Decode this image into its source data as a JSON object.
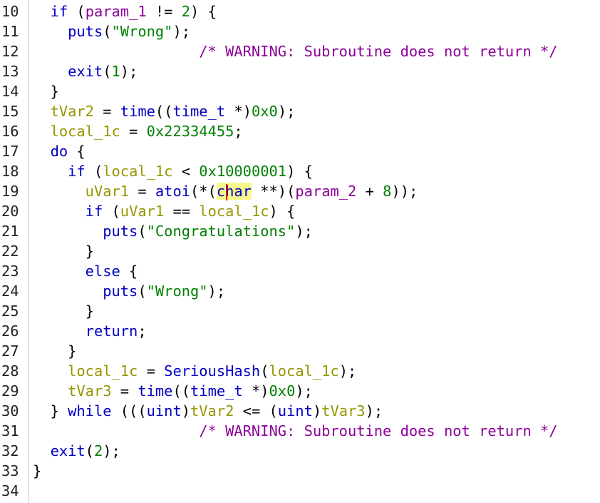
{
  "colors": {
    "keyword": "#0000c4",
    "function": "#0000c4",
    "type": "#0000c4",
    "variable": "#969600",
    "param": "#8c0098",
    "constant": "#008000",
    "string": "#008000",
    "comment": "#8c0098",
    "plain": "#000000",
    "highlight": "#f7f78c",
    "cursor": "#e00000"
  },
  "lines": [
    {
      "number": "10",
      "tokens": [
        {
          "t": "  "
        },
        {
          "t": "if",
          "c": "keyword"
        },
        {
          "t": " ("
        },
        {
          "t": "param_1",
          "c": "param"
        },
        {
          "t": " != "
        },
        {
          "t": "2",
          "c": "constant"
        },
        {
          "t": ") {"
        }
      ]
    },
    {
      "number": "11",
      "tokens": [
        {
          "t": "    "
        },
        {
          "t": "puts",
          "c": "function"
        },
        {
          "t": "("
        },
        {
          "t": "\"Wrong\"",
          "c": "string"
        },
        {
          "t": ");"
        }
      ]
    },
    {
      "number": "12",
      "tokens": [
        {
          "t": "                   "
        },
        {
          "t": "/* WARNING: Subroutine does not return */",
          "c": "comment"
        }
      ]
    },
    {
      "number": "13",
      "tokens": [
        {
          "t": "    "
        },
        {
          "t": "exit",
          "c": "function"
        },
        {
          "t": "("
        },
        {
          "t": "1",
          "c": "constant"
        },
        {
          "t": ");"
        }
      ]
    },
    {
      "number": "14",
      "tokens": [
        {
          "t": "  }"
        }
      ]
    },
    {
      "number": "15",
      "tokens": [
        {
          "t": "  "
        },
        {
          "t": "tVar2",
          "c": "variable"
        },
        {
          "t": " = "
        },
        {
          "t": "time",
          "c": "function"
        },
        {
          "t": "(("
        },
        {
          "t": "time_t",
          "c": "type"
        },
        {
          "t": " *)"
        },
        {
          "t": "0x0",
          "c": "constant"
        },
        {
          "t": ");"
        }
      ]
    },
    {
      "number": "16",
      "tokens": [
        {
          "t": "  "
        },
        {
          "t": "local_1c",
          "c": "variable"
        },
        {
          "t": " = "
        },
        {
          "t": "0x22334455",
          "c": "constant"
        },
        {
          "t": ";"
        }
      ]
    },
    {
      "number": "17",
      "tokens": [
        {
          "t": "  "
        },
        {
          "t": "do",
          "c": "keyword"
        },
        {
          "t": " {"
        }
      ]
    },
    {
      "number": "18",
      "tokens": [
        {
          "t": "    "
        },
        {
          "t": "if",
          "c": "keyword"
        },
        {
          "t": " ("
        },
        {
          "t": "local_1c",
          "c": "variable"
        },
        {
          "t": " < "
        },
        {
          "t": "0x10000001",
          "c": "constant"
        },
        {
          "t": ") {"
        }
      ]
    },
    {
      "number": "19",
      "tokens": [
        {
          "t": "      "
        },
        {
          "t": "uVar1",
          "c": "variable"
        },
        {
          "t": " = "
        },
        {
          "t": "atoi",
          "c": "function"
        },
        {
          "t": "(*("
        },
        {
          "t": "char",
          "c": "type",
          "hl": true
        },
        {
          "t": " **)("
        },
        {
          "t": "param_2",
          "c": "param"
        },
        {
          "t": " + "
        },
        {
          "t": "8",
          "c": "constant"
        },
        {
          "t": "));"
        }
      ]
    },
    {
      "number": "20",
      "tokens": [
        {
          "t": "      "
        },
        {
          "t": "if",
          "c": "keyword"
        },
        {
          "t": " ("
        },
        {
          "t": "uVar1",
          "c": "variable"
        },
        {
          "t": " == "
        },
        {
          "t": "local_1c",
          "c": "variable"
        },
        {
          "t": ") {"
        }
      ]
    },
    {
      "number": "21",
      "tokens": [
        {
          "t": "        "
        },
        {
          "t": "puts",
          "c": "function"
        },
        {
          "t": "("
        },
        {
          "t": "\"Congratulations\"",
          "c": "string"
        },
        {
          "t": ");"
        }
      ]
    },
    {
      "number": "22",
      "tokens": [
        {
          "t": "      }"
        }
      ]
    },
    {
      "number": "23",
      "tokens": [
        {
          "t": "      "
        },
        {
          "t": "else",
          "c": "keyword"
        },
        {
          "t": " {"
        }
      ]
    },
    {
      "number": "24",
      "tokens": [
        {
          "t": "        "
        },
        {
          "t": "puts",
          "c": "function"
        },
        {
          "t": "("
        },
        {
          "t": "\"Wrong\"",
          "c": "string"
        },
        {
          "t": ");"
        }
      ]
    },
    {
      "number": "25",
      "tokens": [
        {
          "t": "      }"
        }
      ]
    },
    {
      "number": "26",
      "tokens": [
        {
          "t": "      "
        },
        {
          "t": "return",
          "c": "keyword"
        },
        {
          "t": ";"
        }
      ]
    },
    {
      "number": "27",
      "tokens": [
        {
          "t": "    }"
        }
      ]
    },
    {
      "number": "28",
      "tokens": [
        {
          "t": "    "
        },
        {
          "t": "local_1c",
          "c": "variable"
        },
        {
          "t": " = "
        },
        {
          "t": "SeriousHash",
          "c": "function"
        },
        {
          "t": "("
        },
        {
          "t": "local_1c",
          "c": "variable"
        },
        {
          "t": ");"
        }
      ]
    },
    {
      "number": "29",
      "tokens": [
        {
          "t": "    "
        },
        {
          "t": "tVar3",
          "c": "variable"
        },
        {
          "t": " = "
        },
        {
          "t": "time",
          "c": "function"
        },
        {
          "t": "(("
        },
        {
          "t": "time_t",
          "c": "type"
        },
        {
          "t": " *)"
        },
        {
          "t": "0x0",
          "c": "constant"
        },
        {
          "t": ");"
        }
      ]
    },
    {
      "number": "30",
      "tokens": [
        {
          "t": "  } "
        },
        {
          "t": "while",
          "c": "keyword"
        },
        {
          "t": " ((("
        },
        {
          "t": "uint",
          "c": "type"
        },
        {
          "t": ")"
        },
        {
          "t": "tVar2",
          "c": "variable"
        },
        {
          "t": " <= ("
        },
        {
          "t": "uint",
          "c": "type"
        },
        {
          "t": ")"
        },
        {
          "t": "tVar3",
          "c": "variable"
        },
        {
          "t": ");"
        }
      ]
    },
    {
      "number": "31",
      "tokens": [
        {
          "t": "                   "
        },
        {
          "t": "/* WARNING: Subroutine does not return */",
          "c": "comment"
        }
      ]
    },
    {
      "number": "32",
      "tokens": [
        {
          "t": "  "
        },
        {
          "t": "exit",
          "c": "function"
        },
        {
          "t": "("
        },
        {
          "t": "2",
          "c": "constant"
        },
        {
          "t": ");"
        }
      ]
    },
    {
      "number": "33",
      "tokens": [
        {
          "t": "}"
        }
      ]
    },
    {
      "number": "34",
      "tokens": []
    }
  ]
}
